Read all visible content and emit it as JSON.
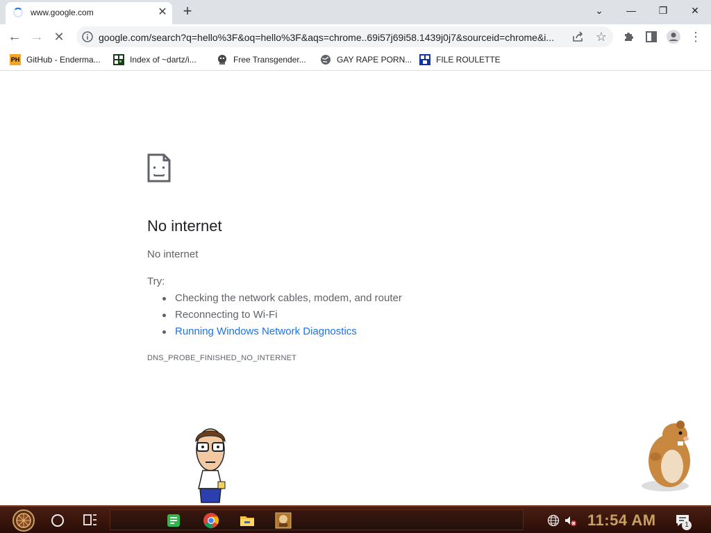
{
  "browser": {
    "tab": {
      "title": "www.google.com",
      "close_glyph": "✕"
    },
    "new_tab_glyph": "+",
    "window_controls": {
      "tabsearch_glyph": "⌄",
      "minimize_glyph": "—",
      "restore_glyph": "❐",
      "close_glyph": "✕"
    },
    "toolbar": {
      "back_glyph": "←",
      "forward_glyph": "→",
      "stop_glyph": "✕",
      "url": "google.com/search?q=hello%3F&oq=hello%3F&aqs=chrome..69i57j69i58.1439j0j7&sourceid=chrome&i...",
      "star_glyph": "☆",
      "menu_glyph": "⋮"
    },
    "bookmarks": [
      {
        "label": "GitHub - Enderma...",
        "icon": "ph-favicon",
        "badge": "PH"
      },
      {
        "label": "Index of ~dartz/i...",
        "icon": "qr-favicon"
      },
      {
        "label": "Free Transgender...",
        "icon": "character-favicon"
      },
      {
        "label": "GAY RAPE PORN...",
        "icon": "globe-favicon"
      },
      {
        "label": "FILE ROULETTE",
        "icon": "grid-favicon"
      }
    ]
  },
  "error_page": {
    "title": "No internet",
    "subtitle": "No internet",
    "try_label": "Try:",
    "suggestions": [
      "Checking the network cables, modem, and router",
      "Reconnecting to Wi-Fi"
    ],
    "suggestion_link": "Running Windows Network Diagnostics",
    "error_code": "DNS_PROBE_FINISHED_NO_INTERNET"
  },
  "taskbar": {
    "clock": "11:54 AM",
    "notification_count": "1",
    "apps": [
      "notes-app",
      "chrome",
      "file-explorer",
      "game-app"
    ]
  },
  "colors": {
    "accent": "#1a73e8",
    "tabstrip": "#dee1e6",
    "taskbar": "#3a1710",
    "clock": "#c8a060"
  }
}
